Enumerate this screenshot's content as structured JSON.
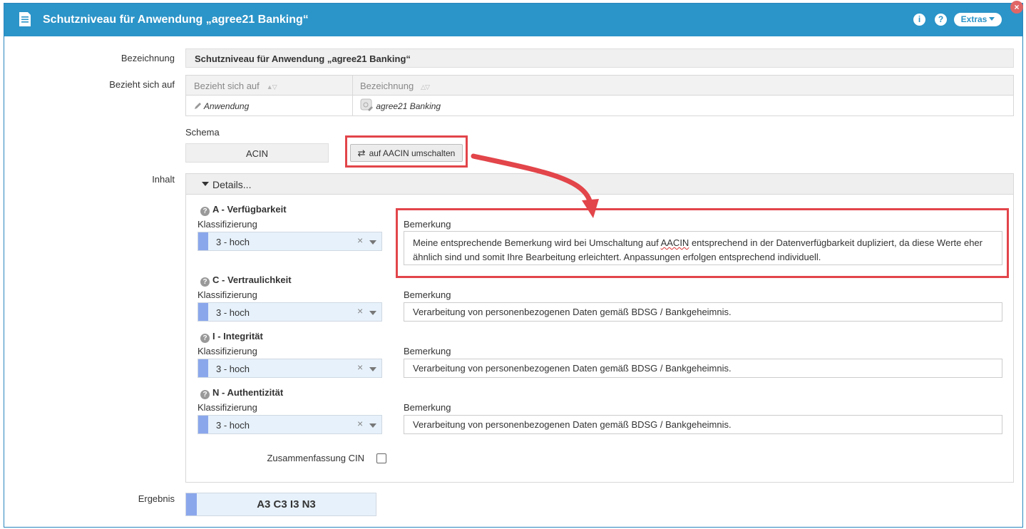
{
  "window": {
    "title": "Schutzniveau für Anwendung „agree21 Banking“",
    "info_icon": "info-icon",
    "help_icon": "help-icon",
    "extras_label": "Extras",
    "close_icon": "close-icon",
    "accent_color": "#2b94c8"
  },
  "form": {
    "bezeichnung_label": "Bezeichnung",
    "bezeichnung_value": "Schutzniveau für Anwendung „agree21 Banking“",
    "bezieht_label": "Bezieht sich auf",
    "grid": {
      "columns": [
        "Bezieht sich auf",
        "Bezeichnung"
      ],
      "rows": [
        {
          "type": "Anwendung",
          "name": "agree21 Banking"
        }
      ]
    },
    "schema_label": "Schema",
    "schema_value": "ACIN",
    "switch_button": "auf AACIN umschalten",
    "inhalt_label": "Inhalt",
    "details_label": "Details...",
    "sections": [
      {
        "title": "A - Verfügbarkeit",
        "klass_label": "Klassifizierung",
        "klass_value": "3 - hoch",
        "bem_label": "Bemerkung",
        "bem_pre": "Meine entsprechende Bemerkung wird bei Umschaltung auf ",
        "bem_word": "AACIN",
        "bem_post": " entsprechend in der Datenverfügbarkeit dupliziert, da diese Werte eher ähnlich sind und somit Ihre Bearbeitung erleichtert. Anpassungen erfolgen entsprechend individuell."
      },
      {
        "title": "C - Vertraulichkeit",
        "klass_label": "Klassifizierung",
        "klass_value": "3 - hoch",
        "bem_label": "Bemerkung",
        "bem_value": "Verarbeitung von personenbezogenen Daten gemäß BDSG / Bankgeheimnis."
      },
      {
        "title": "I - Integrität",
        "klass_label": "Klassifizierung",
        "klass_value": "3 - hoch",
        "bem_label": "Bemerkung",
        "bem_value": "Verarbeitung von personenbezogenen Daten gemäß BDSG / Bankgeheimnis."
      },
      {
        "title": "N - Authentizität",
        "klass_label": "Klassifizierung",
        "klass_value": "3 - hoch",
        "bem_label": "Bemerkung",
        "bem_value": "Verarbeitung von personenbezogenen Daten gemäß BDSG / Bankgeheimnis."
      }
    ],
    "zusammenfassung_label": "Zusammenfassung CIN",
    "zusammenfassung_checked": false,
    "ergebnis_label": "Ergebnis",
    "ergebnis_value": "A3 C3 I3 N3"
  },
  "colors": {
    "highlight_red": "#e2454a",
    "select_bar": "#8ba7ec",
    "select_bg": "#e6f1fb"
  }
}
